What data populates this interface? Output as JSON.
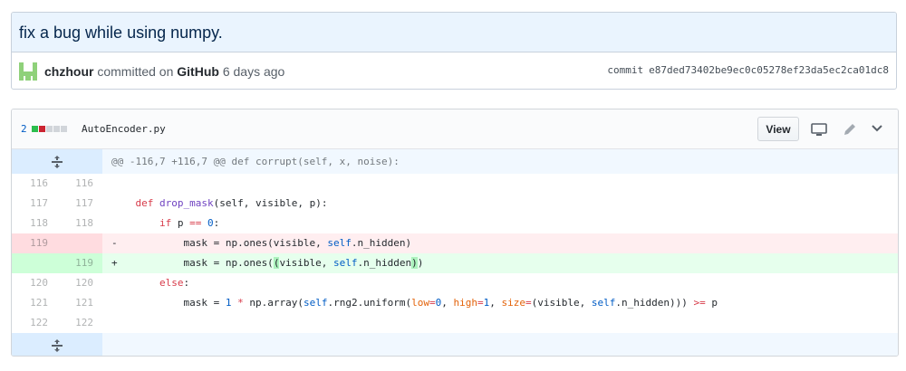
{
  "commit": {
    "title": "fix a bug while using numpy.",
    "author": "chzhour",
    "committed_on_text": " committed on ",
    "committer": "GitHub",
    "age": " 6 days ago",
    "sha_label": "commit",
    "sha": "e87ded73402be9ec0c05278ef23da5ec2ca01dc8"
  },
  "file": {
    "changes": "2",
    "diffstat": [
      "add",
      "del",
      "neu",
      "neu",
      "neu"
    ],
    "name": "AutoEncoder.py",
    "view_label": "View"
  },
  "diff": {
    "hunk_header": "@@ -116,7 +116,7 @@ def corrupt(self, x, noise):",
    "lines": [
      {
        "type": "ctx",
        "left": "116",
        "right": "116",
        "sign": " "
      },
      {
        "type": "ctx",
        "left": "117",
        "right": "117",
        "sign": " "
      },
      {
        "type": "ctx",
        "left": "118",
        "right": "118",
        "sign": " "
      },
      {
        "type": "del",
        "left": "119",
        "right": "",
        "sign": "-"
      },
      {
        "type": "add",
        "left": "",
        "right": "119",
        "sign": "+"
      },
      {
        "type": "ctx",
        "left": "120",
        "right": "120",
        "sign": " "
      },
      {
        "type": "ctx",
        "left": "121",
        "right": "121",
        "sign": " "
      },
      {
        "type": "ctx",
        "left": "122",
        "right": "122",
        "sign": " "
      }
    ]
  },
  "colors": {
    "title_bar": "#eaf4fe",
    "addition_bg": "#e6ffed",
    "deletion_bg": "#ffeef0",
    "expander_bg": "#dbedff"
  },
  "icons": [
    "avatar-identicon",
    "unfold-icon",
    "desktop-icon",
    "pencil-icon",
    "chevron-down-icon"
  ]
}
